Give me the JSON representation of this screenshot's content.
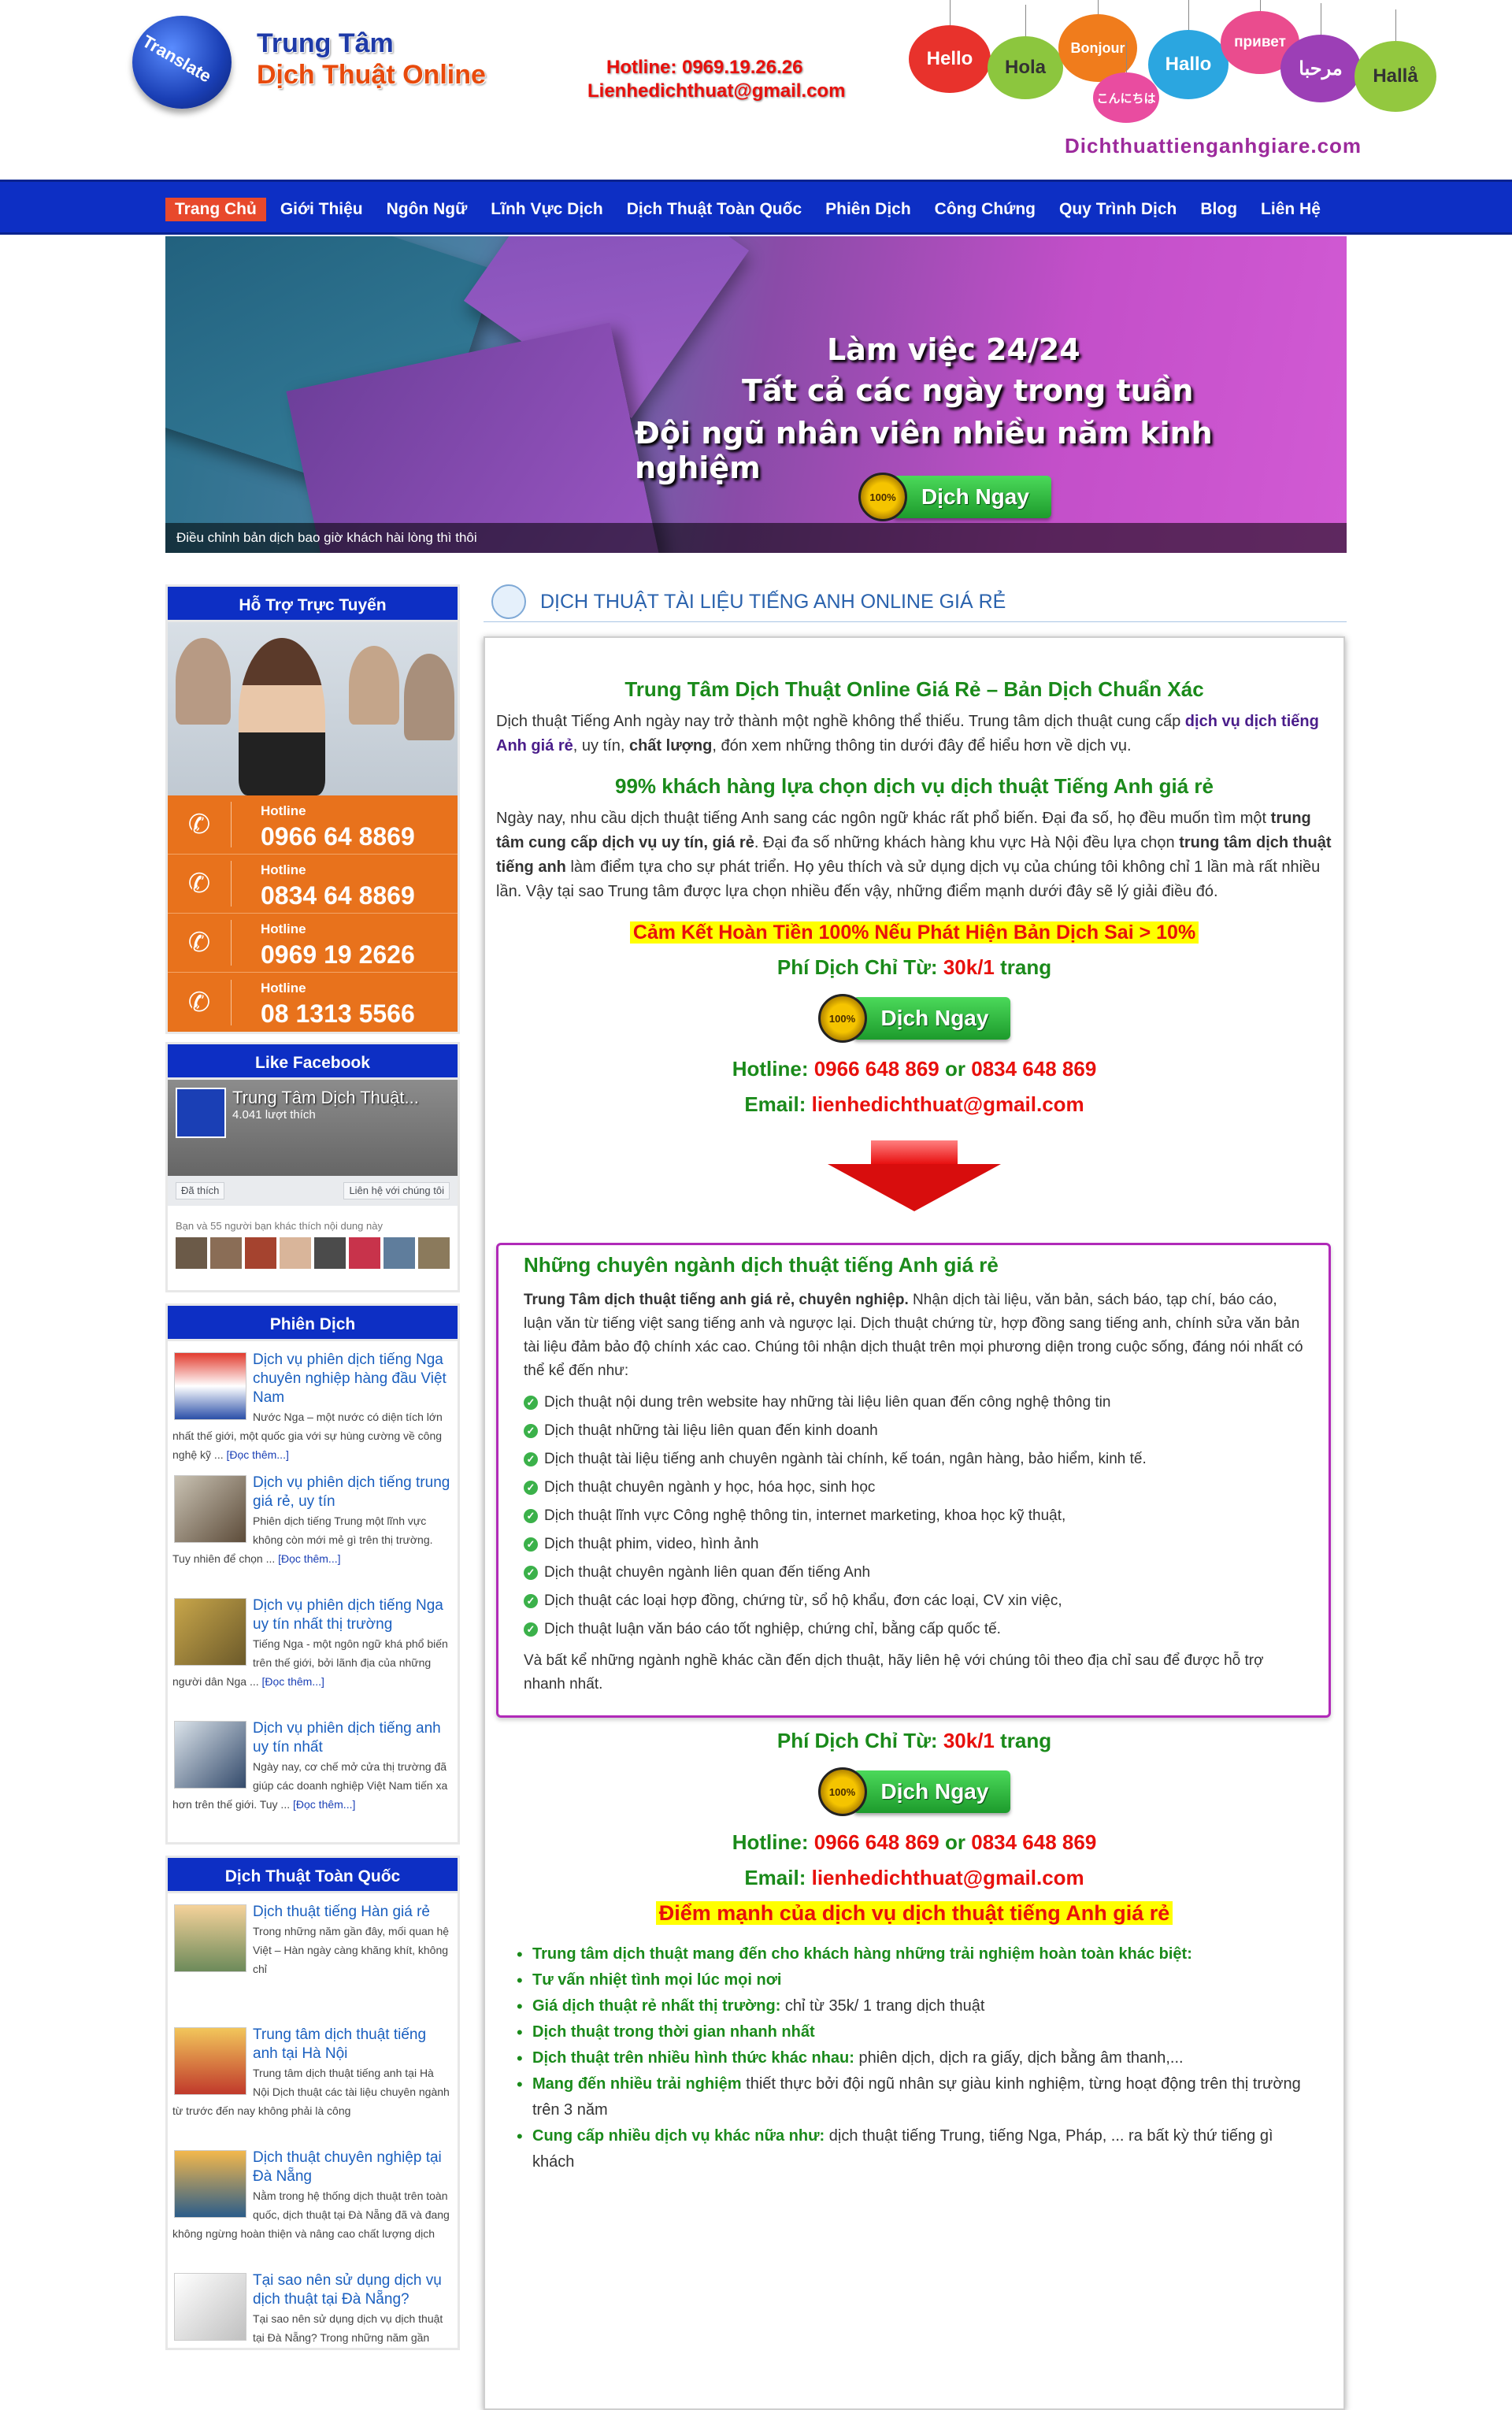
{
  "header": {
    "logo_badge": "Translate",
    "logo_line1": "Trung Tâm",
    "logo_line2": "Dịch Thuật Online",
    "hotline": "Hotline: 0969.19.26.26",
    "email": "Lienhedichthuat@gmail.com",
    "bubbles": [
      "Hello",
      "Hola",
      "Bonjour",
      "こんにちは",
      "Hallo",
      "привет",
      "مرحبا",
      "Hallå"
    ],
    "site_url": "Dichthuattienganhgiare.com"
  },
  "nav": {
    "items": [
      "Trang Chủ",
      "Giới Thiệu",
      "Ngôn Ngữ",
      "Lĩnh Vực Dịch",
      "Dịch Thuật Toàn Quốc",
      "Phiên Dịch",
      "Công Chứng",
      "Quy Trình Dịch",
      "Blog",
      "Liên Hệ"
    ],
    "active": "Trang Chủ"
  },
  "banner": {
    "line1": "Làm việc 24/24",
    "line2": "Tất cả các ngày trong tuần",
    "line3": "Đội ngũ nhân viên nhiều năm kinh nghiệm",
    "button": "Dịch Ngay",
    "medal": "100%",
    "caption": "Điều chỉnh bản dịch bao giờ khách hài lòng thì thôi"
  },
  "sidebar": {
    "support_title": "Hỗ Trợ Trực Tuyến",
    "hotline_label": "Hotline",
    "hotlines": [
      "0966 64 8869",
      "0834 64 8869",
      "0969 19 2626",
      "08 1313 5566"
    ],
    "fb_title": "Like Facebook",
    "fb_page": "Trung Tâm Dịch Thuật...",
    "fb_likes": "4.041 lượt thích",
    "fb_liked": "Đã thích",
    "fb_contact": "Liên hệ với chúng tôi",
    "fb_friends": "Bạn và 55 người bạn khác thích nội dung này",
    "phien_title": "Phiên Dịch",
    "phien_posts": [
      {
        "title": "Dịch vụ phiên dịch tiếng Nga chuyên nghiệp hàng đầu Việt Nam",
        "excerpt": "Nước Nga – một nước có diện tích lớn nhất thế giới, một quốc gia với sự hùng cường về công nghệ kỹ ...",
        "more": "[Đọc thêm...]"
      },
      {
        "title": "Dịch vụ phiên dịch tiếng trung giá rẻ, uy tín",
        "excerpt": "Phiên dịch tiếng Trung một lĩnh vực không còn mới mẻ gì trên thị trường. Tuy nhiên để chọn ...",
        "more": "[Đọc thêm...]"
      },
      {
        "title": "Dịch vụ phiên dịch tiếng Nga uy tín nhất thị trường",
        "excerpt": "Tiếng Nga - một ngôn ngữ khá phổ biến trên thế giới, bởi lãnh địa của những người dân Nga ...",
        "more": "[Đọc thêm...]"
      },
      {
        "title": "Dịch vụ phiên dịch tiếng anh uy tín nhất",
        "excerpt": "Ngày nay, cơ chế mở cửa thị trường đã giúp các doanh nghiệp Việt Nam tiến xa hơn trên thế giới. Tuy ...",
        "more": "[Đọc thêm...]"
      }
    ],
    "toanquoc_title": "Dịch Thuật Toàn Quốc",
    "toanquoc_posts": [
      {
        "title": "Dịch thuật tiếng Hàn giá rẻ",
        "excerpt": "Trong những năm gần đây, mối quan hệ Việt – Hàn ngày càng khăng khít, không chỉ"
      },
      {
        "title": "Trung tâm dịch thuật tiếng anh tại Hà Nội",
        "excerpt": "Trung tâm dịch thuật tiếng anh tại Hà Nội Dịch thuật các tài liệu chuyên ngành từ trước đến nay không phải là công"
      },
      {
        "title": "Dịch thuật chuyên nghiệp tại Đà Nẵng",
        "excerpt": "Nằm trong hệ thống dịch thuật trên toàn quốc, dịch thuật tại Đà Nẵng đã và đang không ngừng hoàn thiện và nâng cao chất lượng dịch"
      },
      {
        "title": "Tại sao nên sử dụng dịch vụ dịch thuật tại Đà Nẵng?",
        "excerpt": "Tại sao nên sử dụng dịch vụ dịch thuật tại Đà Nẵng? Trong những năm gần"
      }
    ]
  },
  "main": {
    "heading": "DỊCH THUẬT TÀI LIỆU TIẾNG ANH ONLINE GIÁ RẺ",
    "h1": "Trung Tâm Dịch Thuật Online Giá Rẻ – Bản Dịch Chuẩn Xác",
    "p1_a": "Dịch thuật Tiếng Anh ngày nay trở thành một nghề không thể thiếu. Trung tâm dịch thuật cung cấp ",
    "p1_link": "dịch vụ dịch tiếng Anh giá rẻ",
    "p1_b": ", uy tín, ",
    "p1_bold": "chất lượng",
    "p1_c": ", đón xem những thông tin dưới đây để hiểu hơn về dịch vụ.",
    "h2": "99% khách hàng lựa chọn dịch vụ dịch thuật Tiếng Anh giá rẻ",
    "p2_a": "Ngày nay, nhu cầu dịch thuật tiếng Anh sang các ngôn ngữ khác rất phổ biến. Đại đa số, họ đều muốn tìm một ",
    "p2_b1": "trung tâm cung cấp dịch vụ uy tín, giá rẻ",
    "p2_b": ". Đại đa số những khách hàng khu vực Hà Nội đều lựa chọn ",
    "p2_b2": "trung tâm dịch thuật tiếng anh",
    "p2_c": " làm điểm tựa cho sự phát triển. Họ yêu thích và sử dụng dịch vụ của chúng tôi không chỉ 1 lần mà rất nhiều lần. Vậy tại sao Trung tâm được lựa chọn nhiều đến vậy, những điểm mạnh dưới đây sẽ lý giải điều đó.",
    "refund": "Cảm Kết Hoàn Tiền 100% Nếu Phát Hiện Bản Dịch Sai > 10%",
    "fee_label": "Phí Dịch Chỉ Từ:",
    "fee_value": "30k/1",
    "fee_unit": "trang",
    "button": "Dịch Ngay",
    "medal": "100%",
    "hotline_label": "Hotline:",
    "hotline_value": "0966 648 869",
    "hotline_or": "or",
    "hotline_value2": "0834 648 869",
    "email_label": "Email:",
    "email_value": "lienhedichthuat@gmail.com",
    "box_title": "Những chuyên ngành dịch thuật tiếng Anh giá rẻ",
    "box_intro_bold": "Trung Tâm dịch thuật tiếng anh giá rẻ, chuyên nghiệp.",
    "box_intro": " Nhận dịch tài liệu, văn bản, sách báo, tạp chí, báo cáo, luận văn từ tiếng việt sang tiếng anh và ngược lại. Dịch thuật chứng từ, hợp đồng sang tiếng anh, chính sửa văn bản tài liệu đảm bảo độ chính xác cao. Chúng tôi nhận dịch thuật trên mọi phương diện trong cuộc sống, đáng nói nhất có thể kể đến như:",
    "box_items": [
      "Dịch thuật nội dung trên website hay những tài liệu liên quan đến công nghệ thông tin",
      "Dịch thuật những tài liệu liên quan đến kinh doanh",
      "Dịch thuật tài liệu tiếng anh chuyên ngành tài chính, kế toán, ngân hàng, bảo hiểm, kinh tế.",
      "Dịch thuật chuyên ngành y học, hóa học, sinh học",
      "Dịch thuật lĩnh vực Công nghệ thông tin, internet marketing, khoa học kỹ thuật,",
      "Dịch thuật phim, video, hình ảnh",
      "Dịch thuật chuyên ngành liên quan đến tiếng Anh",
      "Dịch thuật các loại hợp đồng, chứng từ, sổ hộ khẩu, đơn các loại, CV xin việc,",
      "Dịch thuật luận văn báo cáo tốt nghiệp, chứng chỉ, bằng cấp quốc tế."
    ],
    "box_outro": "Và bất kể những ngành nghề khác cần đến dịch thuật, hãy liên hệ với chúng tôi theo địa chỉ sau để được hỗ trợ nhanh nhất.",
    "strengths_title": "Điểm mạnh của dịch vụ dịch thuật tiếng Anh giá rẻ",
    "strengths": [
      {
        "bold": "Trung tâm dịch thuật mang đến cho khách hàng những trải nghiệm hoàn toàn khác biệt:",
        "text": ""
      },
      {
        "bold": "Tư vấn nhiệt tình mọi lúc mọi nơi",
        "text": ""
      },
      {
        "bold": "Giá dịch thuật rẻ nhất thị trường:",
        "text": " chỉ từ 35k/ 1 trang dịch thuật"
      },
      {
        "bold": "Dịch thuật trong thời gian nhanh nhất",
        "text": ""
      },
      {
        "bold": "Dịch thuật trên nhiều hình thức khác nhau:",
        "text": " phiên dịch, dịch ra giấy, dịch bằng âm thanh,..."
      },
      {
        "bold": "Mang đến nhiều trải nghiệm",
        "text": " thiết thực bởi đội ngũ nhân sự giàu kinh nghiệm, từng hoạt động trên thị trường trên 3 năm"
      },
      {
        "bold": "Cung cấp nhiều dịch vụ khác nữa như:",
        "text": " dịch thuật tiếng Trung, tiếng Nga, Pháp, ... ra bất kỳ thứ tiếng gì khách"
      }
    ]
  },
  "colors": {
    "nav": "#0d2fc4",
    "accent": "#e8492c",
    "hotline_bg": "#e8721c",
    "green": "#1a8a1a",
    "red": "#e8100c"
  }
}
